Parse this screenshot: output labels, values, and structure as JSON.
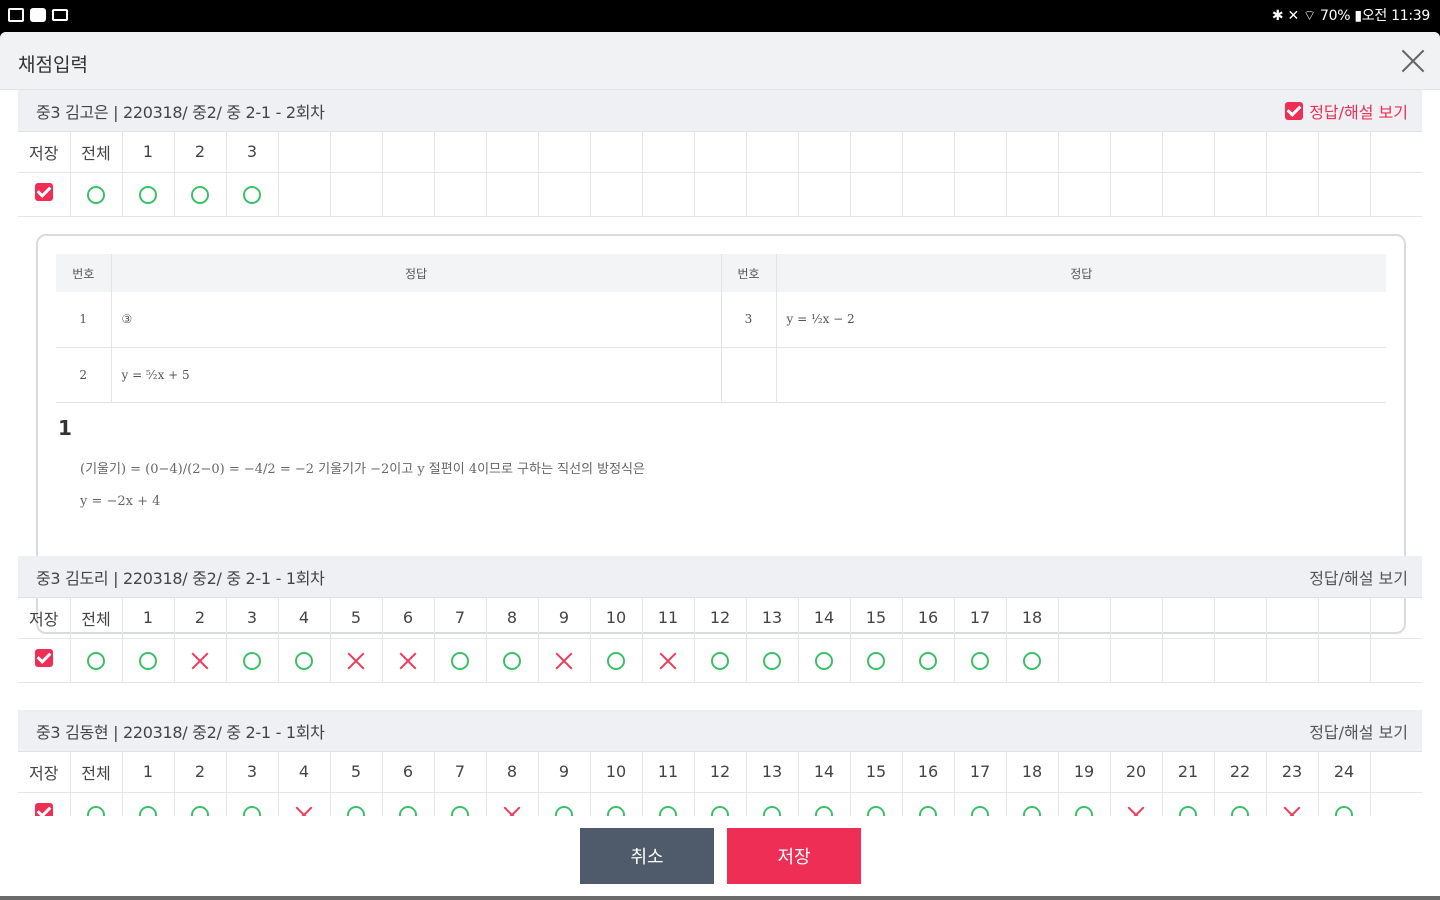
{
  "status_bar": {
    "right": "✱ ✕ ⌔ 70% ▮오전 11:39"
  },
  "dialog": {
    "title": "채점입력"
  },
  "sections": [
    {
      "title": "중3 김고은 | 220318/ 중2/ 중 2-1 - 2회차",
      "toggle_label": "정답/해설 보기",
      "toggle_checked": true,
      "save_label": "저장",
      "all_label": "전체",
      "questions": [
        "1",
        "2",
        "3"
      ],
      "marks": [
        "O",
        "O",
        "O",
        "O"
      ]
    },
    {
      "title": "중3 김도리 | 220318/ 중2/ 중 2-1 - 1회차",
      "toggle_label": "정답/해설 보기",
      "toggle_checked": false,
      "save_label": "저장",
      "all_label": "전체",
      "questions": [
        "1",
        "2",
        "3",
        "4",
        "5",
        "6",
        "7",
        "8",
        "9",
        "10",
        "11",
        "12",
        "13",
        "14",
        "15",
        "16",
        "17",
        "18"
      ],
      "marks": [
        "O",
        "O",
        "X",
        "O",
        "O",
        "X",
        "X",
        "O",
        "O",
        "X",
        "O",
        "X",
        "O",
        "O",
        "O",
        "O",
        "O",
        "O",
        "O"
      ]
    },
    {
      "title": "중3 김동현 | 220318/ 중2/ 중 2-1 - 1회차",
      "toggle_label": "정답/해설 보기",
      "toggle_checked": false,
      "save_label": "저장",
      "all_label": "전체",
      "questions": [
        "1",
        "2",
        "3",
        "4",
        "5",
        "6",
        "7",
        "8",
        "9",
        "10",
        "11",
        "12",
        "13",
        "14",
        "15",
        "16",
        "17",
        "18",
        "19",
        "20",
        "21",
        "22",
        "23",
        "24"
      ],
      "marks": [
        "O",
        "O",
        "O",
        "O",
        "X",
        "O",
        "O",
        "O",
        "X",
        "O",
        "O",
        "O",
        "O",
        "O",
        "O",
        "O",
        "O",
        "O",
        "O",
        "O",
        "X",
        "O",
        "O",
        "X",
        "O"
      ]
    }
  ],
  "answer_panel": {
    "headers": [
      "번호",
      "정답",
      "번호",
      "정답"
    ],
    "rows": [
      {
        "num_left": "1",
        "ans_left": "③",
        "num_right": "3",
        "ans_right": "y = ½x − 2"
      },
      {
        "num_left": "2",
        "ans_left": "y = ⁵⁄₂x + 5",
        "num_right": "",
        "ans_right": ""
      }
    ],
    "explanation": {
      "number": "1",
      "line1": "(기울기) = (0−4)/(2−0) = −4/2 = −2  기울기가 −2이고 y 절편이 4이므로 구하는 직선의 방정식은",
      "line2": "y = −2x + 4"
    }
  },
  "footer": {
    "cancel_label": "취소",
    "save_label": "저장"
  },
  "colors": {
    "accent": "#ee2e55",
    "correct": "#3ec06b",
    "wrong": "#ee3b5a",
    "cancel_bg": "#4f5b6b"
  }
}
